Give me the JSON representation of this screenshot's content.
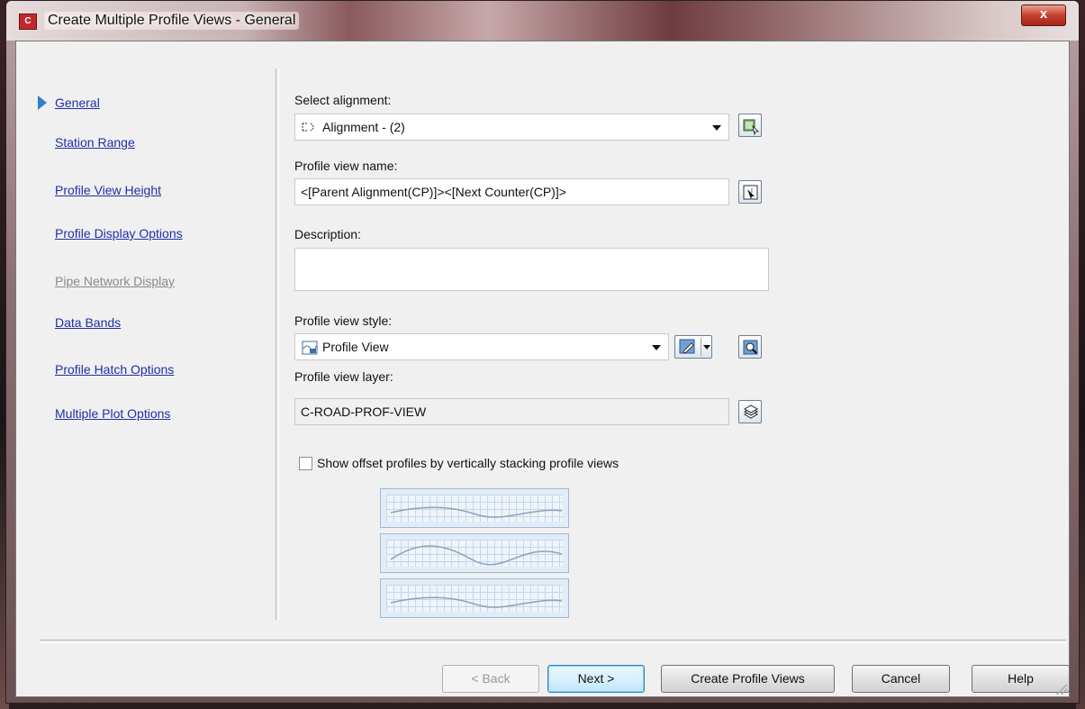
{
  "window": {
    "title": "Create Multiple Profile Views - General",
    "close_label": "x"
  },
  "nav": {
    "items": [
      {
        "label": "General",
        "active": true,
        "enabled": true
      },
      {
        "label": "Station Range",
        "enabled": true
      },
      {
        "label": "Profile View Height",
        "enabled": true
      },
      {
        "label": "Profile Display Options",
        "enabled": true
      },
      {
        "label": "Pipe Network Display",
        "enabled": false
      },
      {
        "label": "Data Bands",
        "enabled": true
      },
      {
        "label": "Profile Hatch Options",
        "enabled": true
      },
      {
        "label": "Multiple Plot Options",
        "enabled": true
      }
    ]
  },
  "form": {
    "select_alignment_label": "Select alignment:",
    "alignment_value": "Alignment - (2)",
    "profile_view_name_label": "Profile view name:",
    "profile_view_name_value": "<[Parent Alignment(CP)]><[Next Counter(CP)]>",
    "description_label": "Description:",
    "description_value": "",
    "profile_view_style_label": "Profile view style:",
    "profile_view_style_value": "Profile View",
    "profile_view_layer_label": "Profile view layer:",
    "profile_view_layer_value": "C-ROAD-PROF-VIEW",
    "stack_checkbox_label": "Show offset profiles by vertically stacking profile views",
    "stack_checked": false
  },
  "footer": {
    "back_label": "< Back",
    "next_label": "Next >",
    "create_label": "Create Profile Views",
    "cancel_label": "Cancel",
    "help_label": "Help"
  }
}
